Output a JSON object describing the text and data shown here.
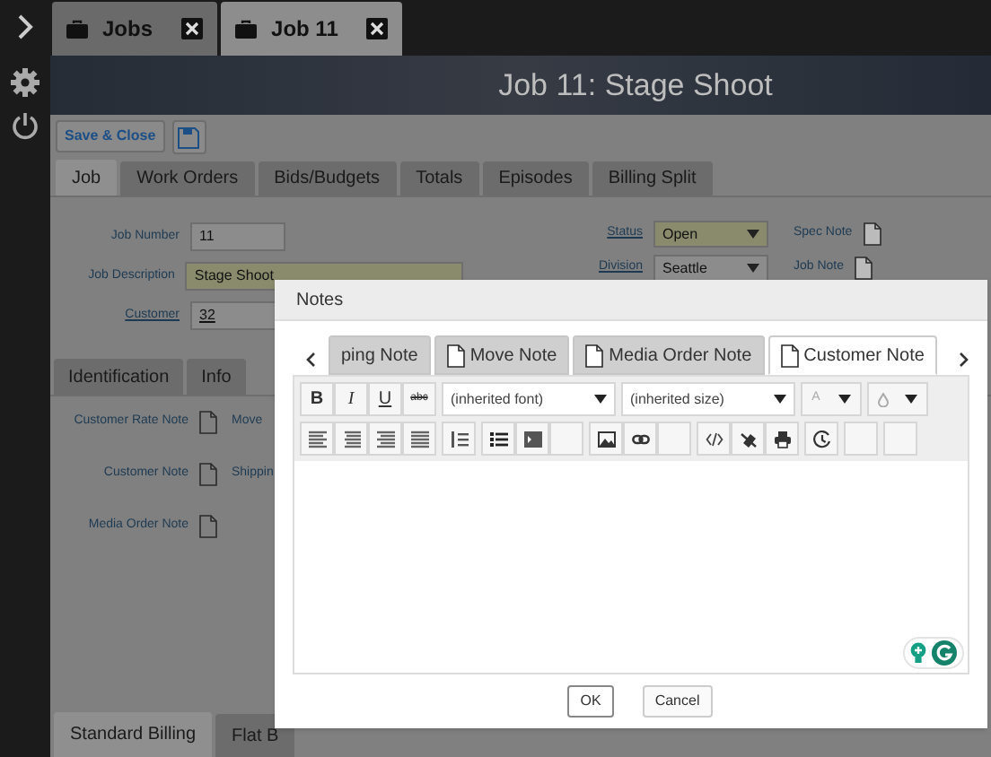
{
  "window_tabs": [
    {
      "label": "Jobs",
      "selected": false
    },
    {
      "label": "Job 11",
      "selected": true
    }
  ],
  "header": {
    "title": "Job 11: Stage Shoot"
  },
  "actions": {
    "save_close": "Save & Close"
  },
  "job_tabs": [
    {
      "label": "Job",
      "selected": true
    },
    {
      "label": "Work Orders",
      "selected": false
    },
    {
      "label": "Bids/Budgets",
      "selected": false
    },
    {
      "label": "Totals",
      "selected": false
    },
    {
      "label": "Episodes",
      "selected": false
    },
    {
      "label": "Billing Split",
      "selected": false
    }
  ],
  "left_fields": [
    {
      "label": "Job Number",
      "value": "11",
      "kind": "plain"
    },
    {
      "label": "Job Description",
      "value": "Stage Shoot",
      "kind": "highlight"
    },
    {
      "label": "Customer",
      "value": "32",
      "kind": "link"
    }
  ],
  "right_fields": [
    {
      "label": "Status",
      "value": "Open",
      "kind": "highlight",
      "note": "Spec Note"
    },
    {
      "label": "Division",
      "value": "Seattle",
      "kind": "plain",
      "note": "Job Note"
    }
  ],
  "sub_tabs": [
    {
      "label": "Identification",
      "selected": false
    },
    {
      "label": "Info",
      "selected": false
    }
  ],
  "notes": [
    {
      "label": "Customer Rate Note",
      "next": "Move"
    },
    {
      "label": "Customer Note",
      "next": "Shippin"
    },
    {
      "label": "Media Order Note"
    }
  ],
  "billing_tabs": [
    {
      "label": "Standard Billing",
      "selected": true
    },
    {
      "label": "Flat B",
      "selected": false
    }
  ],
  "dialog": {
    "title": "Notes",
    "note_tabs": [
      {
        "label": "ping Note",
        "selected": false,
        "icon": false
      },
      {
        "label": "Move Note",
        "selected": false,
        "icon": true
      },
      {
        "label": "Media Order Note",
        "selected": false,
        "icon": true
      },
      {
        "label": "Customer Note",
        "selected": true,
        "icon": true
      }
    ],
    "format_buttons": [
      "B",
      "I",
      "U",
      "abc"
    ],
    "font": "(inherited font)",
    "size": "(inherited size)",
    "color_button": "A",
    "buttons": [
      "OK",
      "Cancel"
    ]
  }
}
